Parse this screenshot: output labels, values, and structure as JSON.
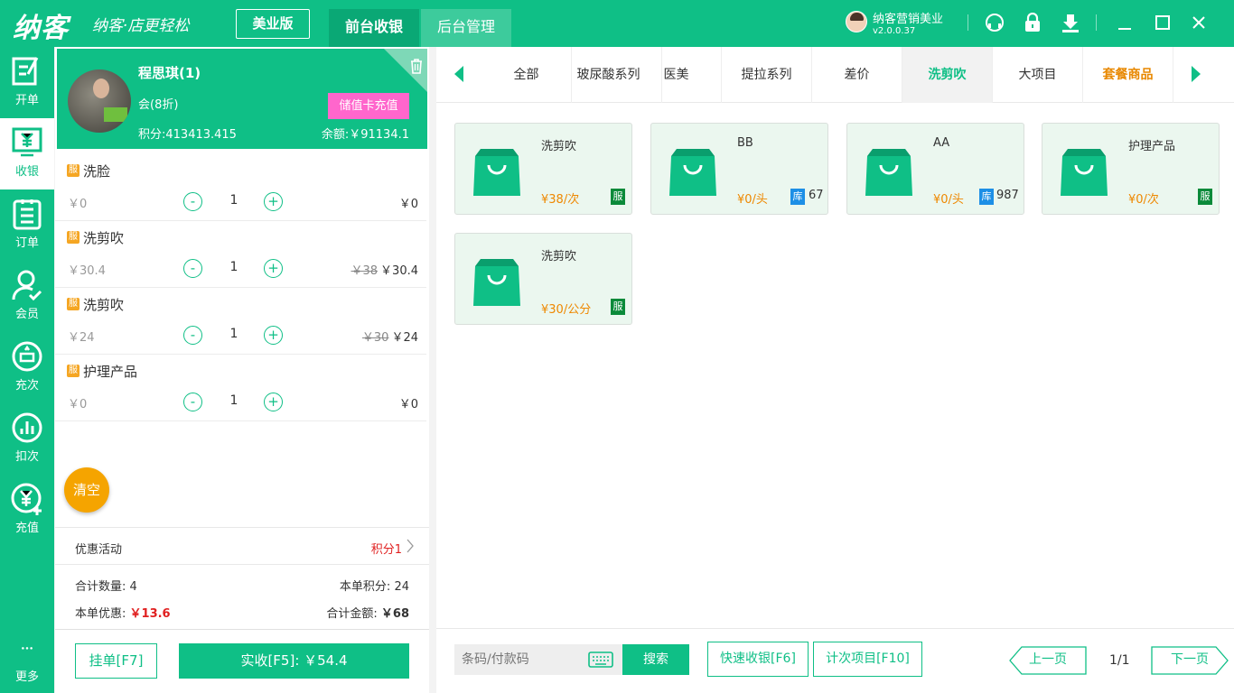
{
  "app": {
    "logo": "纳客",
    "slogan": "纳客·店更轻松",
    "edition": "美业版"
  },
  "nav": {
    "tabs": [
      {
        "label": "前台收银"
      },
      {
        "label": "后台管理"
      }
    ]
  },
  "user": {
    "name": "纳客营销美业",
    "version": "v2.0.0.37"
  },
  "sidebar": {
    "items": [
      {
        "label": "开单",
        "icon": "edit-icon"
      },
      {
        "label": "收银",
        "icon": "yen-monitor-icon"
      },
      {
        "label": "订单",
        "icon": "clipboard-icon"
      },
      {
        "label": "会员",
        "icon": "member-icon"
      },
      {
        "label": "充次",
        "icon": "recharge-times-icon"
      },
      {
        "label": "扣次",
        "icon": "chart-icon"
      },
      {
        "label": "充值",
        "icon": "yen-plus-icon"
      },
      {
        "label": "更多",
        "icon": "more-icon"
      }
    ]
  },
  "member": {
    "name": "程思琪(1)",
    "level": "会(8折)",
    "recharge_label": "储值卡充值",
    "points": "积分:413413.415",
    "balance": "余额:￥91134.1"
  },
  "cart": {
    "items": [
      {
        "tag": "服",
        "name": "洗脸",
        "price": "￥0",
        "qty": "1",
        "orig": "",
        "total": "￥0"
      },
      {
        "tag": "服",
        "name": "洗剪吹",
        "price": "￥30.4",
        "qty": "1",
        "orig": "￥38",
        "total": "￥30.4"
      },
      {
        "tag": "服",
        "name": "洗剪吹",
        "price": "￥24",
        "qty": "1",
        "orig": "￥30",
        "total": "￥24"
      },
      {
        "tag": "服",
        "name": "护理产品",
        "price": "￥0",
        "qty": "1",
        "orig": "",
        "total": "￥0"
      }
    ],
    "minus": "-",
    "plus": "+"
  },
  "clear_label": "清空",
  "promo": {
    "label": "优惠活动",
    "value": "积分1"
  },
  "summary": {
    "count_label": "合计数量:",
    "count": "4",
    "points_label": "本单积分:",
    "points": "24",
    "discount_label": "本单优惠:",
    "discount": "￥13.6",
    "total_label": "合计金额:",
    "total": "￥68"
  },
  "footer": {
    "hang_label": "挂单[F7]",
    "pay_label": "实收[F5]:  ￥54.4"
  },
  "categories": [
    {
      "label": "全部"
    },
    {
      "label": "玻尿酸系列"
    },
    {
      "label": "医美"
    },
    {
      "label": "提拉系列"
    },
    {
      "label": "差价"
    },
    {
      "label": "洗剪吹"
    },
    {
      "label": "大项目"
    },
    {
      "label": "套餐商品"
    }
  ],
  "products": [
    {
      "name": "洗剪吹",
      "price": "¥38/次",
      "badge": "服",
      "stock_badge": "",
      "stock": ""
    },
    {
      "name": "BB",
      "price": "¥0/头",
      "badge": "",
      "stock_badge": "库",
      "stock": "67"
    },
    {
      "name": "AA",
      "price": "¥0/头",
      "badge": "",
      "stock_badge": "库",
      "stock": "987"
    },
    {
      "name": "护理产品",
      "price": "¥0/次",
      "badge": "服",
      "stock_badge": "",
      "stock": ""
    },
    {
      "name": "洗剪吹",
      "price": "¥30/公分",
      "badge": "服",
      "stock_badge": "",
      "stock": ""
    }
  ],
  "bottom": {
    "search_placeholder": "条码/付款码",
    "search_label": "搜索",
    "quick_label": "快速收银[F6]",
    "count_label": "计次项目[F10]",
    "prev_label": "上一页",
    "page": "1/1",
    "next_label": "下一页"
  },
  "colors": {
    "brand": "#0fbf86",
    "recharge": "#ff66cc",
    "price": "#ee8800",
    "discount": "#e02020",
    "clear": "#f5a400"
  }
}
